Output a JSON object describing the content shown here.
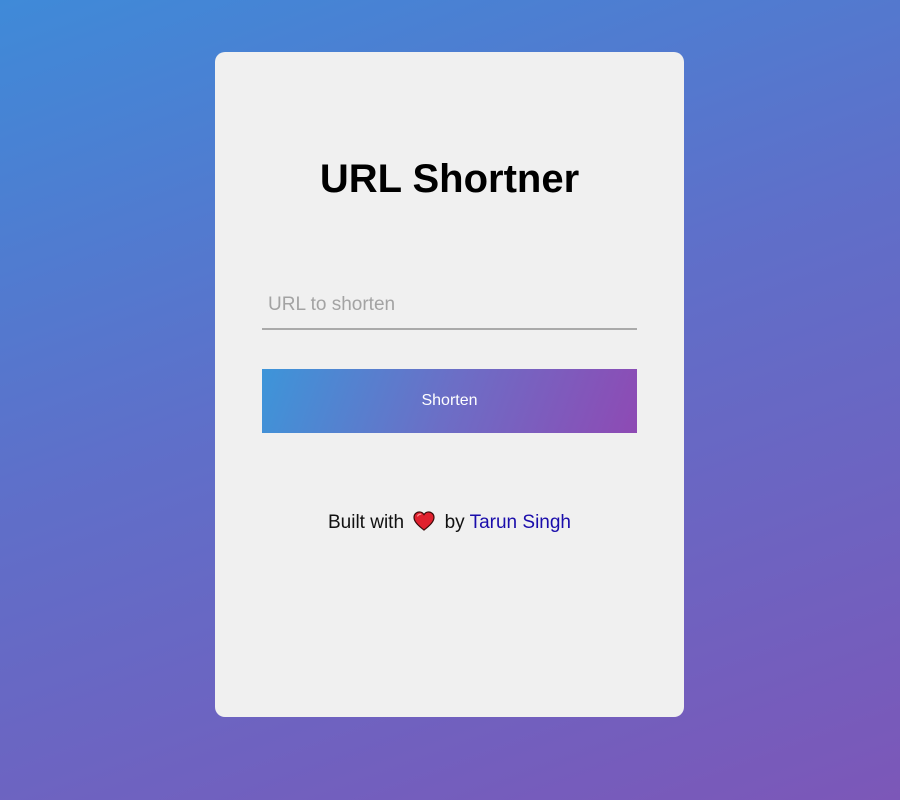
{
  "page": {
    "title": "URL Shortner"
  },
  "form": {
    "input_placeholder": "URL to shorten",
    "input_value": "",
    "shorten_label": "Shorten"
  },
  "footer": {
    "prefix": "Built with",
    "icon": "heart-icon",
    "middle": "by",
    "author": "Tarun Singh"
  },
  "colors": {
    "background_gradient_start": "#3f8ad8",
    "background_gradient_end": "#7c57b8",
    "card_background": "#f0f0f0",
    "button_gradient_start": "#3d95d9",
    "button_gradient_end": "#8e4ab4",
    "link": "#1a0dab",
    "heart": "#e0202e"
  }
}
